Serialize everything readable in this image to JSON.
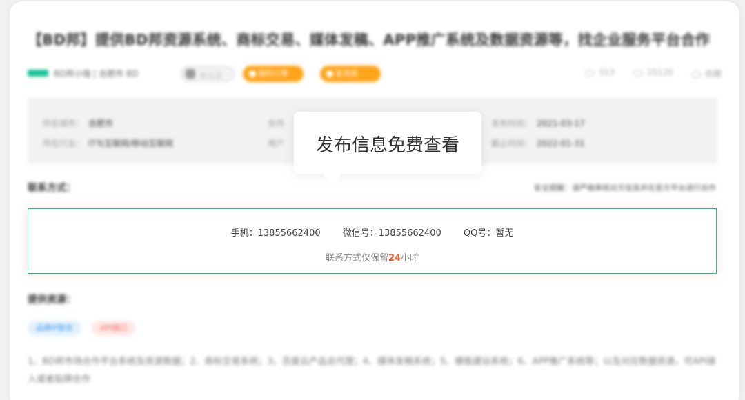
{
  "title": "【BD邦】提供BD邦资源系统、商标交易、媒体发稿、APP推广系统及数据资源等，找企业服务平台合作",
  "meta": {
    "company": "BD邦小强 | 合肥市 BD",
    "tag": "未认证",
    "btn_view": "我的订单",
    "btn_message": "发消息",
    "likes": "313",
    "views": "25120",
    "favorite": "收藏"
  },
  "info": {
    "city_label": "所在城市：",
    "city_value": "合肥市",
    "industry_label": "所在行业：",
    "industry_value": "IT与互联网/移动互联网",
    "coop_label": "合作",
    "user_label": "用户",
    "publish_label": "发布时间：",
    "publish_value": "2021-03-17",
    "deadline_label": "截止时间：",
    "deadline_value": "2022-01-31"
  },
  "contact": {
    "label": "联系方式：",
    "safety": "安全提醒：请严格审核对方信息并在官方平台进行合作",
    "phone": "手机：13855662400",
    "wechat": "微信号：13855662400",
    "qq": "QQ号：暂无",
    "note_prefix": "联系方式仅保留",
    "note_hours": "24",
    "note_suffix": "小时"
  },
  "tooltip": "发布信息免费查看",
  "resources": {
    "label": "提供资源：",
    "tags": [
      "品牌IP联合",
      "API接口"
    ],
    "description": "1、BD邦市场合作平台系统及资源数据；2、商标交易系统；3、百度云产品总代理；4、媒体发稿系统；5、模板建站系统；6、APP推广系统等；以及对应数据资源，可API接入或者贴牌合作"
  }
}
